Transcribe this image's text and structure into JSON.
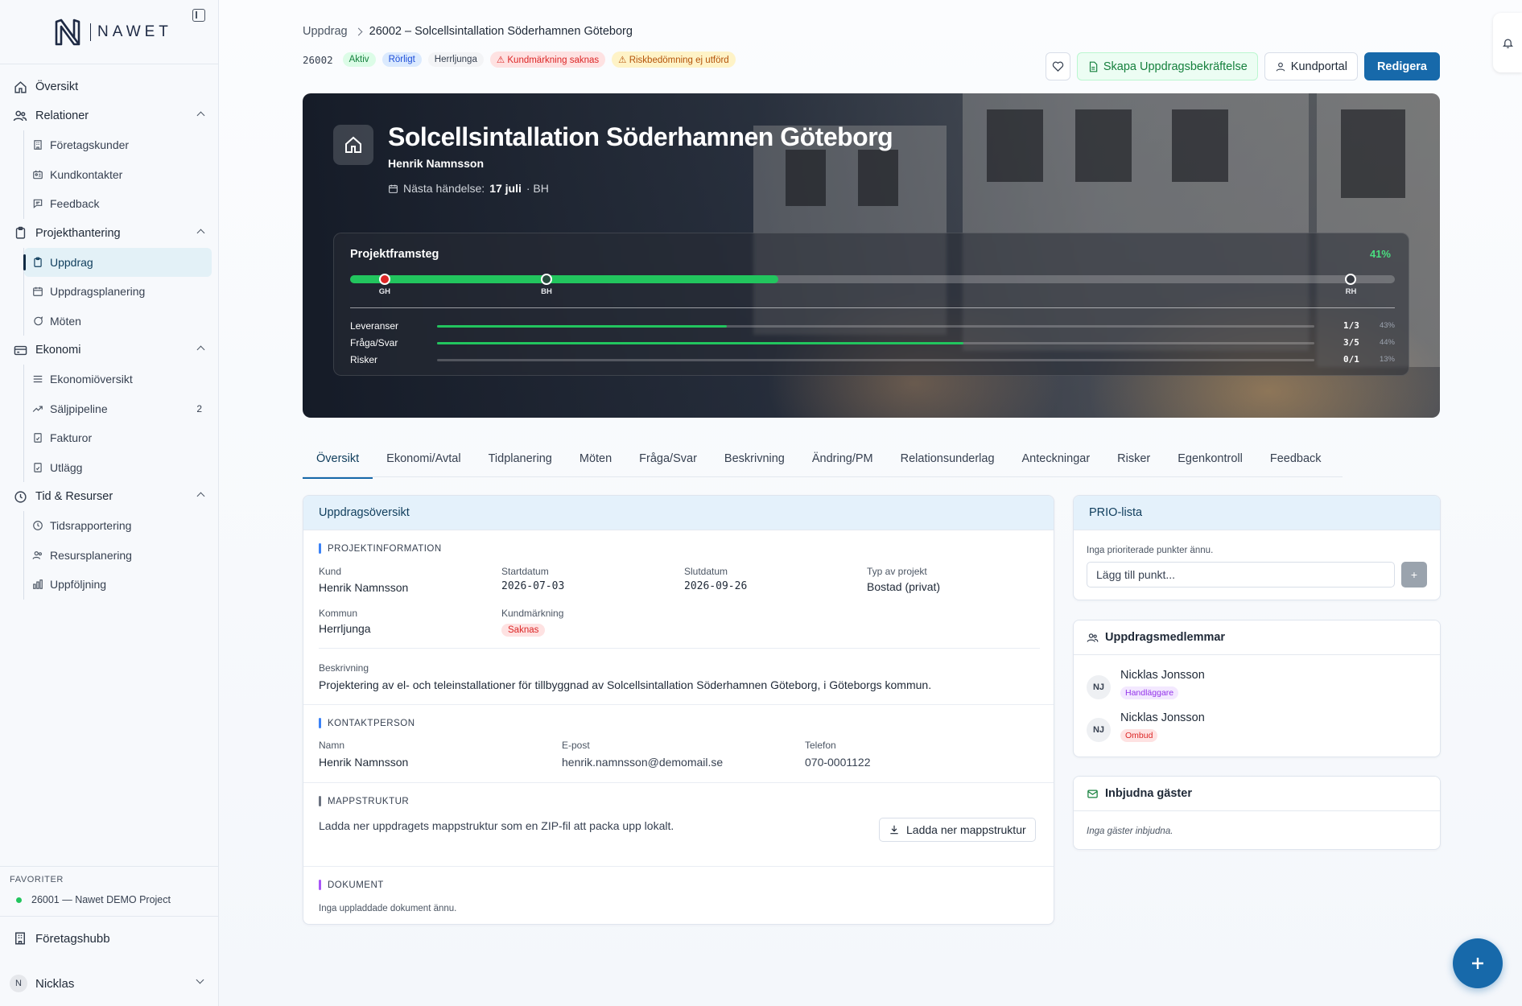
{
  "app": {
    "logo_text": "NAWET"
  },
  "sidebar": {
    "groups": [
      {
        "label": "Översikt",
        "icon": "home-icon"
      },
      {
        "label": "Relationer",
        "icon": "users-icon",
        "items": [
          {
            "label": "Företagskunder",
            "icon": "building-icon"
          },
          {
            "label": "Kundkontakter",
            "icon": "contact-card-icon"
          },
          {
            "label": "Feedback",
            "icon": "message-icon"
          }
        ]
      },
      {
        "label": "Projekthantering",
        "icon": "clipboard-icon",
        "items": [
          {
            "label": "Uppdrag",
            "icon": "clipboard-icon"
          },
          {
            "label": "Uppdragsplanering",
            "icon": "calendar-icon"
          },
          {
            "label": "Möten",
            "icon": "chat-bubble-icon"
          }
        ]
      },
      {
        "label": "Ekonomi",
        "icon": "wallet-icon",
        "items": [
          {
            "label": "Ekonomiöversikt",
            "icon": "list-icon"
          },
          {
            "label": "Säljpipeline",
            "icon": "trend-icon",
            "count": "2"
          },
          {
            "label": "Fakturor",
            "icon": "receipt-icon"
          },
          {
            "label": "Utlägg",
            "icon": "receipt-icon"
          }
        ]
      },
      {
        "label": "Tid & Resurser",
        "icon": "clock-icon",
        "items": [
          {
            "label": "Tidsrapportering",
            "icon": "clock-icon"
          },
          {
            "label": "Resursplanering",
            "icon": "users-icon"
          },
          {
            "label": "Uppföljning",
            "icon": "bar-chart-icon"
          }
        ]
      }
    ],
    "favorites_label": "FAVORITER",
    "favorite_item": "26001 — Nawet DEMO Project",
    "hub_label": "Företagshubb",
    "user_initial": "N",
    "user_name": "Nicklas"
  },
  "breadcrumb": {
    "root": "Uppdrag",
    "current": "26002 – Solcellsintallation Söderhamnen Göteborg"
  },
  "tags": {
    "id": "26002",
    "status": "Aktiv",
    "pricing": "Rörligt",
    "municipality": "Herrljunga",
    "warn1": "Kundmärkning saknas",
    "warn2": "Riskbedömning ej utförd"
  },
  "actions": {
    "confirm": "Skapa Uppdragsbekräftelse",
    "portal": "Kundportal",
    "edit": "Redigera"
  },
  "hero": {
    "title": "Solcellsintallation Söderhamnen Göteborg",
    "client": "Henrik Namnsson",
    "next_label": "Nästa händelse:",
    "next_date": "17 juli",
    "next_code": "· BH",
    "progress_title": "Projektframsteg",
    "progress_pct": "41%",
    "progress_value": 0.41,
    "milestones": [
      {
        "label": "GH",
        "pos": 0.033,
        "done": true
      },
      {
        "label": "BH",
        "pos": 0.188,
        "done": false
      },
      {
        "label": "RH",
        "pos": 0.958,
        "done": false
      }
    ],
    "metrics": [
      {
        "label": "Leveranser",
        "frac": "1/3",
        "pct": "43%",
        "value": 0.33
      },
      {
        "label": "Fråga/Svar",
        "frac": "3/5",
        "pct": "44%",
        "value": 0.6
      },
      {
        "label": "Risker",
        "frac": "0/1",
        "pct": "13%",
        "value": 0
      }
    ]
  },
  "tabs": [
    "Översikt",
    "Ekonomi/Avtal",
    "Tidplanering",
    "Möten",
    "Fråga/Svar",
    "Beskrivning",
    "Ändring/PM",
    "Relationsunderlag",
    "Anteckningar",
    "Risker",
    "Egenkontroll",
    "Feedback"
  ],
  "overview": {
    "title": "Uppdragsöversikt",
    "info_title": "PROJEKTINFORMATION",
    "kund_label": "Kund",
    "kund": "Henrik Namnsson",
    "start_label": "Startdatum",
    "start": "2026-07-03",
    "end_label": "Slutdatum",
    "end": "2026-09-26",
    "type_label": "Typ av projekt",
    "type": "Bostad (privat)",
    "kommun_label": "Kommun",
    "kommun": "Herrljunga",
    "mark_label": "Kundmärkning",
    "mark": "Saknas",
    "desc_label": "Beskrivning",
    "desc": "Projektering av el- och teleinstallationer för tillbyggnad av Solcellsintallation Söderhamnen Göteborg, i Göteborgs kommun.",
    "contact_title": "KONTAKTPERSON",
    "name_label": "Namn",
    "name": "Henrik Namnsson",
    "email_label": "E-post",
    "email": "henrik.namnsson@demomail.se",
    "phone_label": "Telefon",
    "phone": "070-0001122",
    "folder_title": "MAPPSTRUKTUR",
    "folder_text": "Ladda ner uppdragets mappstruktur som en ZIP-fil att packa upp lokalt.",
    "folder_btn": "Ladda ner mappstruktur",
    "docs_title": "DOKUMENT",
    "docs_text": "Inga uppladdade dokument ännu."
  },
  "prio": {
    "title": "PRIO-lista",
    "empty": "Inga prioriterade punkter ännu.",
    "placeholder": "Lägg till punkt...",
    "add": "+"
  },
  "members": {
    "title": "Uppdragsmedlemmar",
    "list": [
      {
        "initials": "NJ",
        "name": "Nicklas Jonsson",
        "role": "Handläggare"
      },
      {
        "initials": "NJ",
        "name": "Nicklas Jonsson",
        "role": "Ombud"
      }
    ]
  },
  "guests": {
    "title": "Inbjudna gäster",
    "empty": "Inga gäster inbjudna."
  },
  "colors": {
    "primary": "#1769aa",
    "success": "#22c55e",
    "danger": "#dc2626",
    "warning": "#b45309"
  }
}
